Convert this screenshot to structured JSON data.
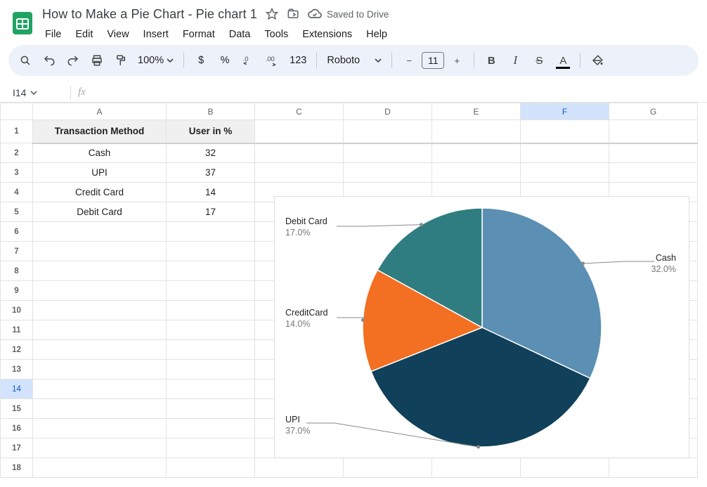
{
  "app": {
    "doc_title": "How to Make a Pie Chart - Pie chart 1",
    "saved_text": "Saved to Drive"
  },
  "menus": {
    "file": "File",
    "edit": "Edit",
    "view": "View",
    "insert": "Insert",
    "format": "Format",
    "data": "Data",
    "tools": "Tools",
    "extensions": "Extensions",
    "help": "Help"
  },
  "toolbar": {
    "zoom": "100%",
    "currency": "$",
    "percent": "%",
    "dec_dec": ".0",
    "inc_dec": ".00",
    "num_fmt": "123",
    "font": "Roboto",
    "font_size": "11",
    "bold": "B",
    "italic": "I",
    "strike": "S",
    "textcolor": "A"
  },
  "namebox": {
    "ref": "I14"
  },
  "columns": [
    "A",
    "B",
    "C",
    "D",
    "E",
    "F",
    "G"
  ],
  "rows": [
    "1",
    "2",
    "3",
    "4",
    "5",
    "6",
    "7",
    "8",
    "9",
    "10",
    "11",
    "12",
    "13",
    "14",
    "15",
    "16",
    "17",
    "18"
  ],
  "table": {
    "A1": "Transaction Method",
    "B1": "User in %",
    "A2": "Cash",
    "B2": "32",
    "A3": "UPI",
    "B3": "37",
    "A4": "Credit Card",
    "B4": "14",
    "A5": "Debit Card",
    "B5": "17"
  },
  "chart_data": {
    "type": "pie",
    "title": "",
    "slices": [
      {
        "label": "Cash",
        "value": 32,
        "pct": "32.0%",
        "color": "#5b8fb3"
      },
      {
        "label": "UPI",
        "value": 37,
        "pct": "37.0%",
        "color": "#10405a"
      },
      {
        "label": "CreditCard",
        "value": 14,
        "pct": "14.0%",
        "color": "#f36f21"
      },
      {
        "label": "Debit Card",
        "value": 17,
        "pct": "17.0%",
        "color": "#2f7d80"
      }
    ]
  },
  "chart_labels": {
    "cash_name": "Cash",
    "cash_pct": "32.0%",
    "upi_name": "UPI",
    "upi_pct": "37.0%",
    "credit_name": "CreditCard",
    "credit_pct": "14.0%",
    "debit_name": "Debit Card",
    "debit_pct": "17.0%"
  }
}
